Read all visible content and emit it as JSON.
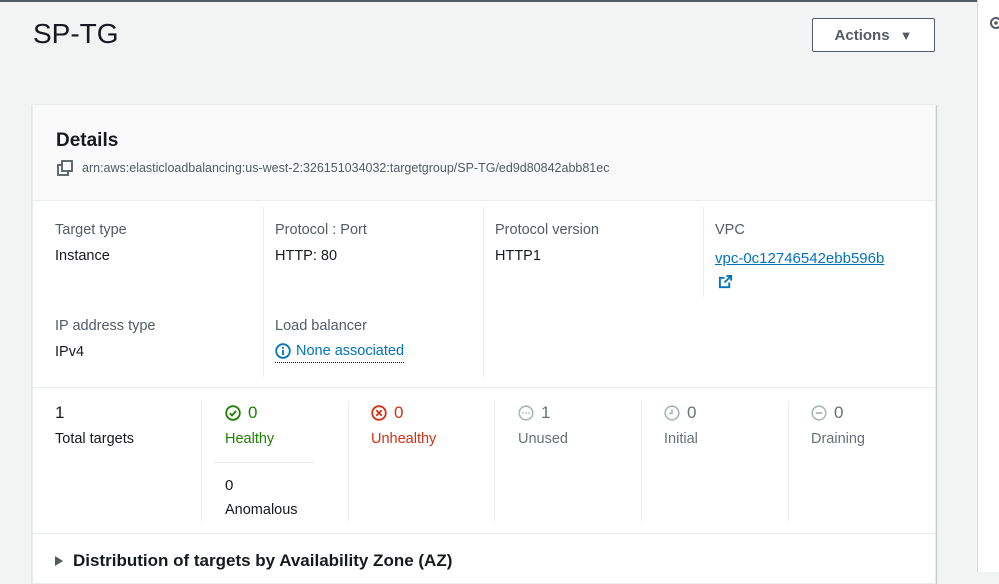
{
  "page": {
    "title": "SP-TG",
    "actions_label": "Actions",
    "actions_caret": "▼"
  },
  "details": {
    "title": "Details",
    "arn": "arn:aws:elasticloadbalancing:us-west-2:326151034032:targetgroup/SP-TG/ed9d80842abb81ec",
    "target_type": {
      "label": "Target type",
      "value": "Instance"
    },
    "protocol_port": {
      "label": "Protocol : Port",
      "value": "HTTP: 80"
    },
    "protocol_version": {
      "label": "Protocol version",
      "value": "HTTP1"
    },
    "vpc": {
      "label": "VPC",
      "value": "vpc-0c12746542ebb596b"
    },
    "ip_address_type": {
      "label": "IP address type",
      "value": "IPv4"
    },
    "load_balancer": {
      "label": "Load balancer",
      "value": "None associated"
    }
  },
  "stats": {
    "total": {
      "count": "1",
      "label": "Total targets"
    },
    "healthy": {
      "count": "0",
      "label": "Healthy"
    },
    "anomalous": {
      "count": "0",
      "label": "Anomalous"
    },
    "unhealthy": {
      "count": "0",
      "label": "Unhealthy"
    },
    "unused": {
      "count": "1",
      "label": "Unused"
    },
    "initial": {
      "count": "0",
      "label": "Initial"
    },
    "draining": {
      "count": "0",
      "label": "Draining"
    }
  },
  "distribution": {
    "label": "Distribution of targets by Availability Zone (AZ)"
  },
  "colors": {
    "link": "#0073bb",
    "healthy": "#1d8102",
    "unhealthy": "#d13212",
    "neutral": "#687078"
  }
}
